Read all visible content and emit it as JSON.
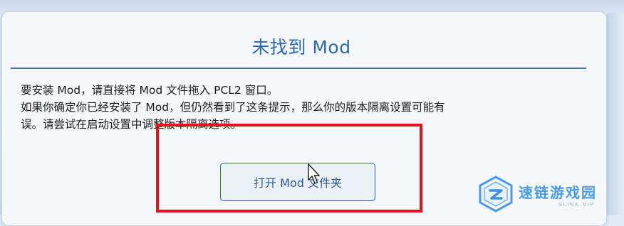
{
  "dialog": {
    "title": "未找到 Mod",
    "line1": "要安装 Mod，请直接将 Mod 文件拖入 PCL2 窗口。",
    "line2": "如果你确定你已经安装了 Mod，但仍然看到了这条提示，那么你的版本隔离设置可能有",
    "line3": "误。请尝试在启动设置中调整版本隔离选项。",
    "button_label": "打开 Mod 文件夹"
  },
  "watermark": {
    "name": "速链游戏园",
    "sub": "SLINK.VIP"
  },
  "colors": {
    "title": "#2f6aa8",
    "divider": "#3f78b8",
    "highlight": "#e0141b",
    "watermark": "#4b9ce8"
  },
  "icons": {
    "cursor": "mouse-pointer-icon",
    "logo": "slink-logo-icon"
  }
}
